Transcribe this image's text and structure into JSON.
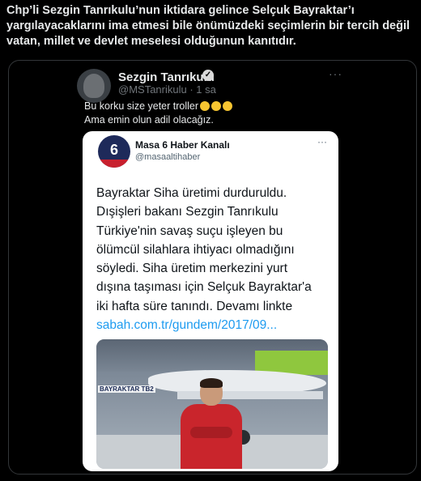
{
  "headline": {
    "line1": "Chp’li Sezgin Tanrıkulu’nun iktidara gelince Selçuk Bayraktar’ı",
    "line2": "yargılayacaklarını ima etmesi bile önümüzdeki seçimlerin bir tercih değil",
    "line3": "vatan, millet ve devlet meselesi olduğunun kanıtıdır."
  },
  "tweet": {
    "author_name": "Sezgin Tanrıkulu",
    "author_handle": "@MSTanrikulu · 1 sa",
    "more_icon": "more-dots-icon",
    "line1": "Bu korku size yeter troller",
    "line2": "Ama emin olun adil olacağız.",
    "emoji_icon": "grinning-face-icon"
  },
  "quoted_tweet": {
    "author_name": "Masa 6 Haber Kanalı",
    "author_handle": "@masaaltihaber",
    "logo_text": "6",
    "lines": [
      "Bayraktar Siha üretimi durduruldu.",
      "Dışişleri bakanı Sezgin Tanrıkulu",
      "Türkiye'nin savaş suçu işleyen bu",
      "ölümcül silahlara ihtiyacı olmadığını",
      "söyledi. Siha üretim merkezini yurt",
      "dışına taşıması için Selçuk Bayraktar'a",
      "iki hafta süre tanındı. Devamı linkte"
    ],
    "link": "sabah.com.tr/gundem/2017/09...",
    "photo_label": "BAYRAKTAR TB2"
  },
  "colors": {
    "background": "#000000",
    "text": "#e7e9ea",
    "muted": "#71767b",
    "link": "#1d9bf0",
    "quote_bg": "#ffffff"
  }
}
